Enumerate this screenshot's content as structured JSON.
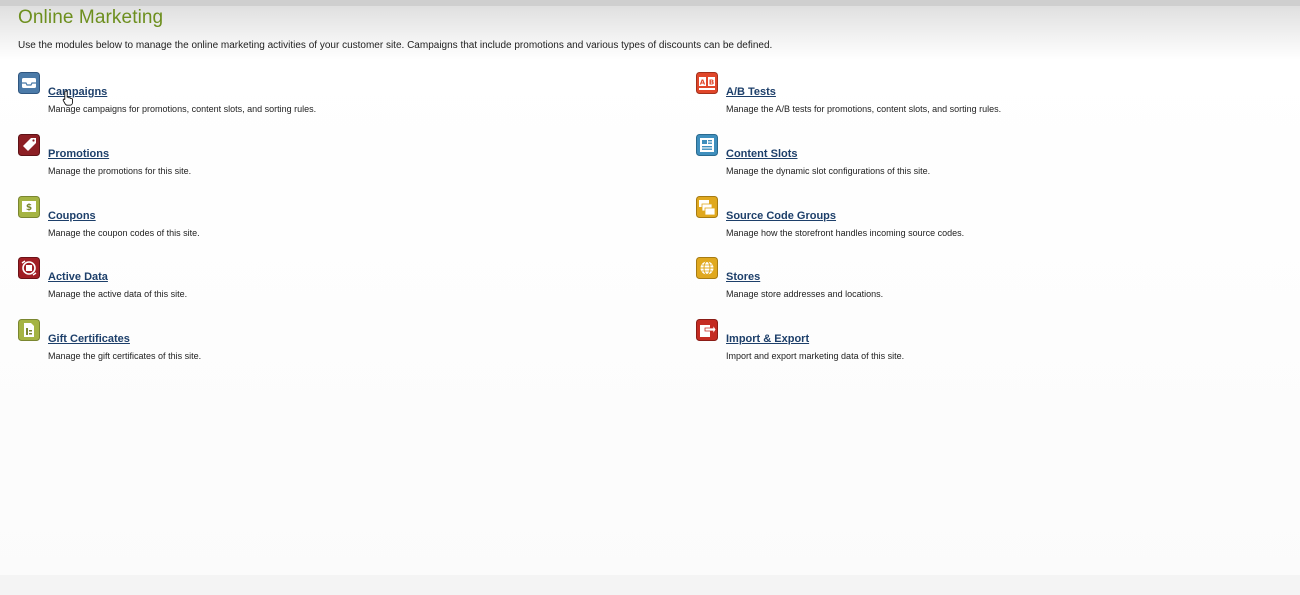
{
  "page": {
    "title": "Online Marketing",
    "intro": "Use the modules below to manage the online marketing activities of your customer site. Campaigns that include promotions and various types of discounts can be defined."
  },
  "modules_left": [
    {
      "label": "Campaigns",
      "description": "Manage campaigns for promotions, content slots, and sorting rules.",
      "icon": "campaigns-icon",
      "color": "#4b7aa8"
    },
    {
      "label": "Promotions",
      "description": "Manage the promotions for this site.",
      "icon": "promotions-tag-icon",
      "color": "#8c1f24"
    },
    {
      "label": "Coupons",
      "description": "Manage the coupon codes of this site.",
      "icon": "coupon-dollar-icon",
      "color": "#a5b443"
    },
    {
      "label": "Active Data",
      "description": "Manage the active data of this site.",
      "icon": "active-data-icon",
      "color": "#a01e24"
    },
    {
      "label": "Gift Certificates",
      "description": "Manage the gift certificates of this site.",
      "icon": "gift-certificate-icon",
      "color": "#a5b443"
    }
  ],
  "modules_right": [
    {
      "label": "A/B Tests",
      "description": "Manage the A/B tests for promotions, content slots, and sorting rules.",
      "icon": "ab-tests-icon",
      "color": "#e0462a"
    },
    {
      "label": "Content Slots",
      "description": "Manage the dynamic slot configurations of this site.",
      "icon": "content-slots-icon",
      "color": "#3f8fbd"
    },
    {
      "label": "Source Code Groups",
      "description": "Manage how the storefront handles incoming source codes.",
      "icon": "source-code-groups-icon",
      "color": "#e0a81e"
    },
    {
      "label": "Stores",
      "description": "Manage store addresses and locations.",
      "icon": "stores-globe-icon",
      "color": "#e0a81e"
    },
    {
      "label": "Import & Export",
      "description": "Import and export marketing data of this site.",
      "icon": "import-export-icon",
      "color": "#c42b22"
    }
  ]
}
